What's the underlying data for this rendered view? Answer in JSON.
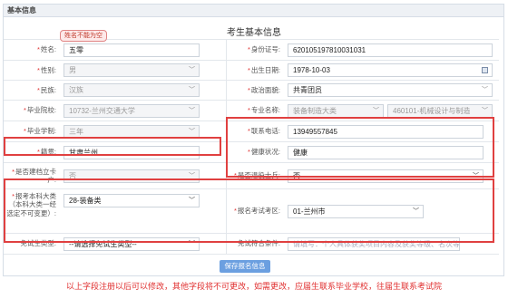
{
  "panel": {
    "title": "基本信息"
  },
  "form": {
    "title": "考生基本信息",
    "tooltip": "姓名不能为空",
    "fields": {
      "name": {
        "label": "姓名:",
        "value": "五零"
      },
      "id_number": {
        "label": "身份证号:",
        "value": "620105197810031031"
      },
      "gender": {
        "label": "性别:",
        "value": "男"
      },
      "birth_date": {
        "label": "出生日期:",
        "value": "1978-10-03"
      },
      "ethnicity": {
        "label": "民族:",
        "value": "汉族"
      },
      "politics": {
        "label": "政治面貌:",
        "value": "共青团员"
      },
      "grad_school": {
        "label": "毕业院校:",
        "value": "10732-兰州交通大学"
      },
      "major": {
        "label": "专业名称:",
        "category": "装备制造大类",
        "value": "460101-机械设计与制造"
      },
      "school_years": {
        "label": "毕业学制:",
        "value": "三年"
      },
      "phone": {
        "label": "联系电话:",
        "value": "13949557845"
      },
      "native_place": {
        "label": "籍贯:",
        "value": "甘肃兰州"
      },
      "health": {
        "label": "健康状况:",
        "value": "健康"
      },
      "poverty": {
        "label": "是否建档立卡户:",
        "value": "否"
      },
      "veteran": {
        "label": "是否退役士兵:",
        "value": "否"
      },
      "apply_major": {
        "label": "报考本科大类（本科大类一经选定不可变更）:",
        "value": "28-装备类"
      },
      "exam_area": {
        "label": "报名考试考区:",
        "value": "01-兰州市"
      },
      "exempt_type": {
        "label": "免试生类型:",
        "value": "--请选择免试生类型--"
      },
      "exempt_condition": {
        "label": "免试符合条件:",
        "placeholder": "请填写：个人具体获奖项目内容及获奖等级、名次等"
      }
    },
    "save_label": "保存报名信息"
  },
  "notice": "以上字段注册以后可以修改，其他字段将不可更改，如需更改，应届生联系毕业学校，往届生联系考试院",
  "colors": {
    "required": "#e03030",
    "highlight": "#e04040",
    "button": "#6b9fe0"
  }
}
